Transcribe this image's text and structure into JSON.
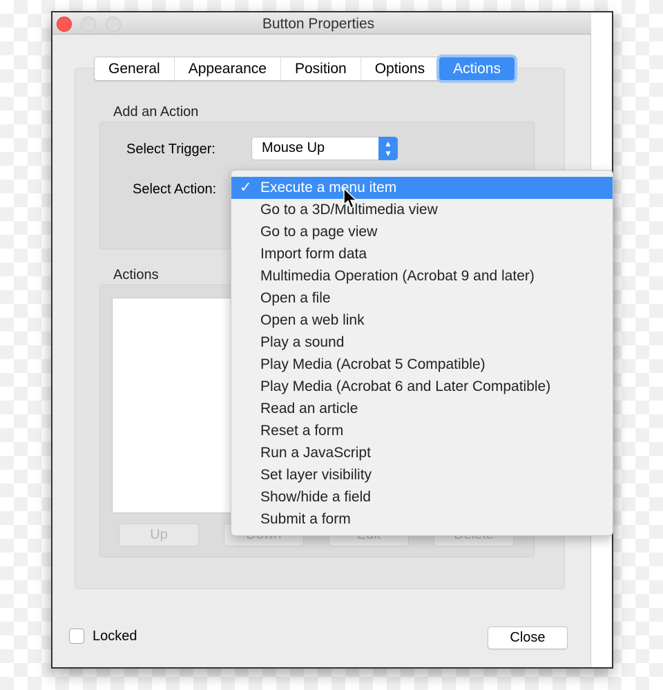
{
  "window": {
    "title": "Button Properties"
  },
  "tabs": [
    {
      "label": "General"
    },
    {
      "label": "Appearance"
    },
    {
      "label": "Position"
    },
    {
      "label": "Options"
    },
    {
      "label": "Actions",
      "active": true
    }
  ],
  "add_action": {
    "heading": "Add an Action",
    "trigger_label": "Select Trigger:",
    "trigger_value": "Mouse Up",
    "action_label": "Select Action:"
  },
  "actions": {
    "heading": "Actions",
    "buttons": [
      "Up",
      "Down",
      "Edit",
      "Delete"
    ]
  },
  "locked_label": "Locked",
  "locked_checked": false,
  "close_label": "Close",
  "menu": {
    "selected_index": 0,
    "items": [
      "Execute a menu item",
      "Go to a 3D/Multimedia view",
      "Go to a page view",
      "Import form data",
      "Multimedia Operation (Acrobat 9 and later)",
      "Open a file",
      "Open a web link",
      "Play a sound",
      "Play Media (Acrobat 5 Compatible)",
      "Play Media (Acrobat 6 and Later Compatible)",
      "Read an article",
      "Reset a form",
      "Run a JavaScript",
      "Set layer visibility",
      "Show/hide a field",
      "Submit a form"
    ]
  },
  "colors": {
    "accent": "#3b8df5",
    "close_light": "#fc5753"
  }
}
